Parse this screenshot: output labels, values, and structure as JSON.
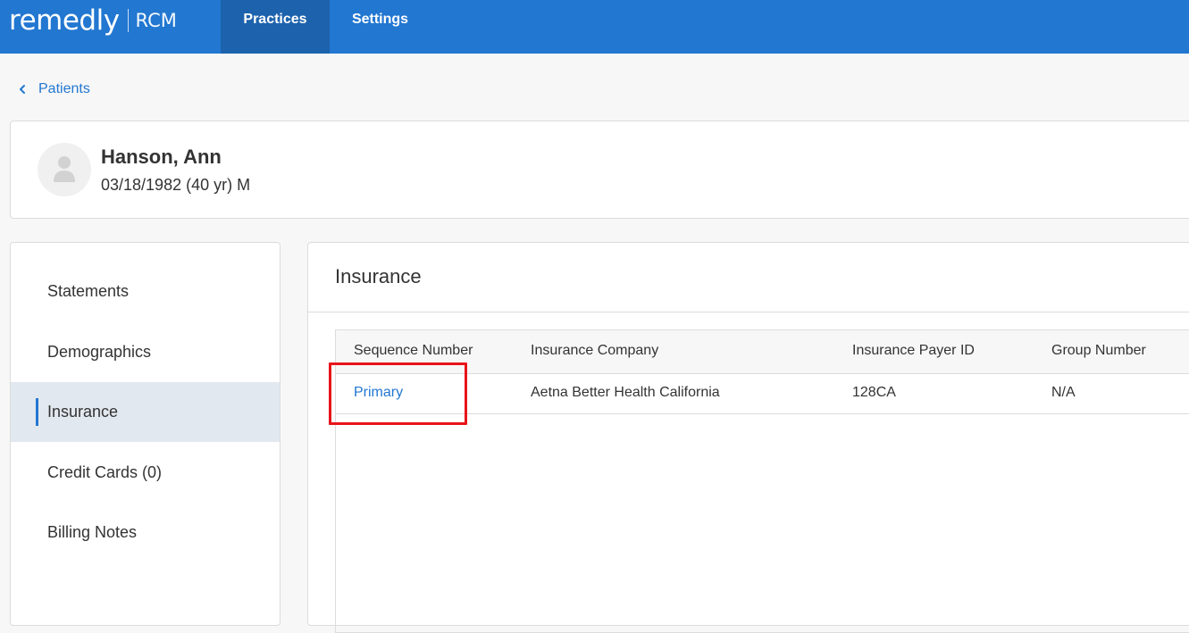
{
  "brand": {
    "name": "remedly",
    "product": "RCM"
  },
  "nav": {
    "tabs": [
      {
        "label": "Practices"
      },
      {
        "label": "Settings"
      }
    ]
  },
  "back": {
    "label": "Patients"
  },
  "patient": {
    "name": "Hanson, Ann",
    "details": "03/18/1982 (40 yr) M"
  },
  "sidebar": {
    "items": [
      {
        "label": "Statements"
      },
      {
        "label": "Demographics"
      },
      {
        "label": "Insurance"
      },
      {
        "label": "Credit Cards (0)"
      },
      {
        "label": "Billing Notes"
      }
    ]
  },
  "insurance": {
    "title": "Insurance",
    "columns": [
      "Sequence Number",
      "Insurance Company",
      "Insurance Payer ID",
      "Group Number"
    ],
    "rows": [
      {
        "sequence": "Primary",
        "company": "Aetna Better Health California",
        "payer_id": "128CA",
        "group": "N/A"
      }
    ]
  },
  "colors": {
    "accent": "#2277d1",
    "nav_active": "#1d62ad",
    "highlight": "#e8141a"
  }
}
